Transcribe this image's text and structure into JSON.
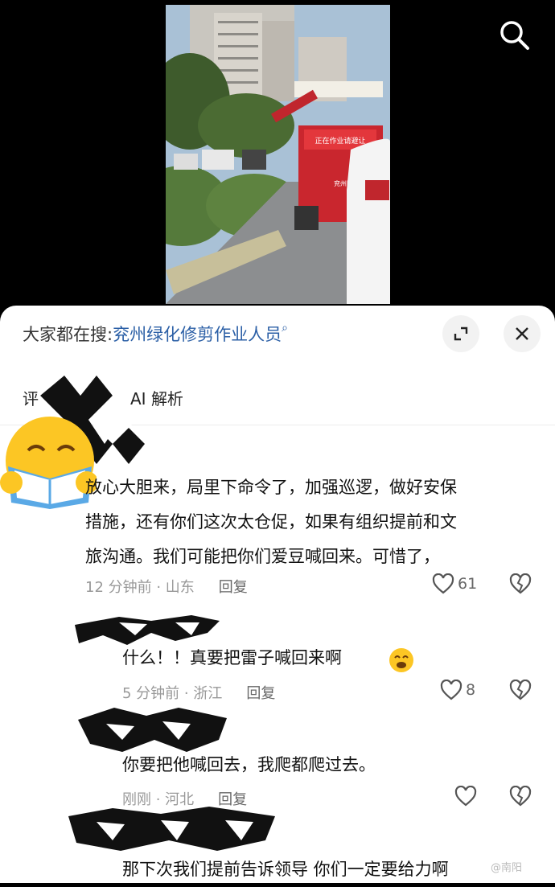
{
  "video": {
    "sign_text": "正在作业请避让",
    "door_text": "兖州园林"
  },
  "header": {
    "prefix": "大家都在搜:",
    "query": "兖州绿化修剪作业人员"
  },
  "tabs": [
    {
      "label": "评"
    },
    {
      "label": "AI 解析"
    }
  ],
  "comments": [
    {
      "lines": [
        "放心大胆来，局里下命令了，加强巡逻，做好安保",
        "措施，还有你们这次太仓促，如果有组织提前和文",
        "旅沟通。我们可能把你们爱豆喊回来。可惜了，"
      ],
      "time_loc": "12 分钟前 · 山东",
      "reply": "回复",
      "likes": "61"
    },
    {
      "lines": [
        "什么！！真要把雷子喊回来啊"
      ],
      "time_loc": "5 分钟前 · 浙江",
      "reply": "回复",
      "likes": "8"
    },
    {
      "lines": [
        "你要把他喊回去，我爬都爬过去。"
      ],
      "time_loc": "刚刚 · 河北",
      "reply": "回复",
      "likes": ""
    },
    {
      "lines": [
        "那下次我们提前告诉领导 你们一定要给力啊"
      ],
      "time_loc": "",
      "reply": "",
      "likes": ""
    }
  ],
  "watermark": "@南阳",
  "icons": [
    "search-icon",
    "expand-icon",
    "close-icon",
    "heart-icon",
    "broken-heart-icon",
    "smile-emoji-icon",
    "reading-emoji-avatar"
  ]
}
